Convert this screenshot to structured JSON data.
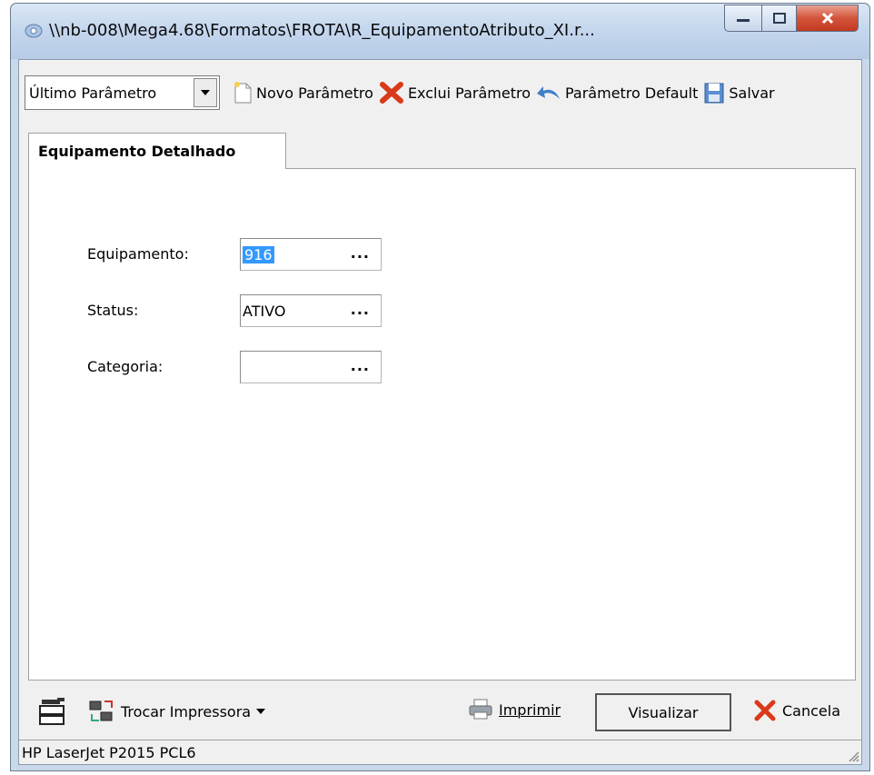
{
  "window": {
    "title": "\\\\nb-008\\Mega4.68\\Formatos\\FROTA\\R_EquipamentoAtributo_XI.r..."
  },
  "toolbar": {
    "combo_value": "Último Parâmetro",
    "novo_label": "Novo Parâmetro",
    "exclui_label": "Exclui Parâmetro",
    "default_label": "Parâmetro Default",
    "salvar_label": "Salvar"
  },
  "tab": {
    "label": "Equipamento Detalhado"
  },
  "fields": {
    "equipamento": {
      "label": "Equipamento:",
      "value": "916"
    },
    "status": {
      "label": "Status:",
      "value": "ATIVO"
    },
    "categoria": {
      "label": "Categoria:",
      "value": ""
    },
    "lookup_button": "..."
  },
  "bottom": {
    "trocar_label": "Trocar Impressora",
    "imprimir_label": "Imprimir",
    "visualizar_label": "Visualizar",
    "cancela_label": "Cancela"
  },
  "status": {
    "printer": "HP LaserJet P2015 PCL6"
  },
  "colors": {
    "selection": "#3399ff",
    "close_button": "#c23a20",
    "delete_icon": "#d93a1a"
  }
}
